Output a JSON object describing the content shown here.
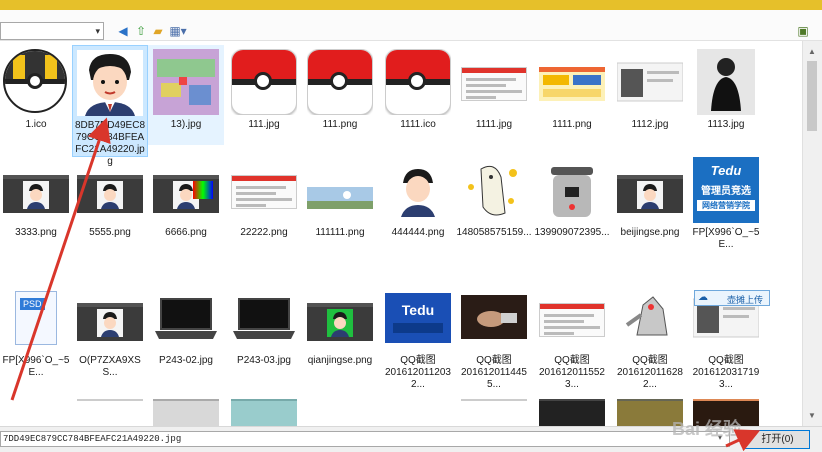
{
  "toolbar": {
    "path_value": "",
    "icons": [
      "back-icon",
      "up-folder-icon",
      "new-folder-icon",
      "view-menu-icon"
    ],
    "preview_icon": "preview-pane-icon"
  },
  "files": [
    {
      "name": "1.ico",
      "type": "ultraball"
    },
    {
      "name": "8DB7DD49EC879CC784BFEAFC21A49220.jpg",
      "type": "avatar",
      "selected": true
    },
    {
      "name": "13).jpg",
      "type": "game",
      "hover": true
    },
    {
      "name": "111.jpg",
      "type": "pokeball"
    },
    {
      "name": "111.png",
      "type": "pokeball"
    },
    {
      "name": "1111.ico",
      "type": "pokeball"
    },
    {
      "name": "1111.jpg",
      "type": "web"
    },
    {
      "name": "1111.png",
      "type": "web-yellow"
    },
    {
      "name": "1112.jpg",
      "type": "web-photo"
    },
    {
      "name": "1113.jpg",
      "type": "person-dark"
    },
    {
      "name": "3333.png",
      "type": "editor"
    },
    {
      "name": "5555.png",
      "type": "editor-avatar"
    },
    {
      "name": "6666.png",
      "type": "editor-color"
    },
    {
      "name": "22222.png",
      "type": "web"
    },
    {
      "name": "111111.png",
      "type": "landscape"
    },
    {
      "name": "444444.png",
      "type": "avatar-small"
    },
    {
      "name": "148058575159...",
      "type": "cartoon"
    },
    {
      "name": "139909072395...",
      "type": "cooker"
    },
    {
      "name": "beijingse.png",
      "type": "editor-avatar"
    },
    {
      "name": "FP[X996`O_~5E...",
      "type": "tedu-banner"
    },
    {
      "name": "FP[X996`O_~5E...",
      "type": "psd"
    },
    {
      "name": "O(P7ZXA9XSS...",
      "type": "editor-avatar"
    },
    {
      "name": "P243-02.jpg",
      "type": "laptop"
    },
    {
      "name": "P243-03.jpg",
      "type": "laptop"
    },
    {
      "name": "qianjingse.png",
      "type": "editor-green"
    },
    {
      "name": "QQ截图\n2016120112032...",
      "type": "tedu"
    },
    {
      "name": "QQ截图\n2016120114455...",
      "type": "hand"
    },
    {
      "name": "QQ截图\n2016120115523...",
      "type": "web"
    },
    {
      "name": "QQ截图\n2016120116282...",
      "type": "pokemon"
    },
    {
      "name": "QQ截图\n2016120317193...",
      "type": "web-photo"
    }
  ],
  "upload_button": {
    "label": "壶摊上传"
  },
  "bottom": {
    "filename_value": "7DD49EC879CC784BFEAFC21A49220.jpg",
    "open_label": "打开(0)"
  },
  "watermark": "Bai 经验",
  "colors": {
    "title_bar": "#e6c02a",
    "selection": "#cce8ff",
    "selection_border": "#99d1ff",
    "annotation_arrow": "#d9362b",
    "open_button_border": "#0078d7"
  }
}
